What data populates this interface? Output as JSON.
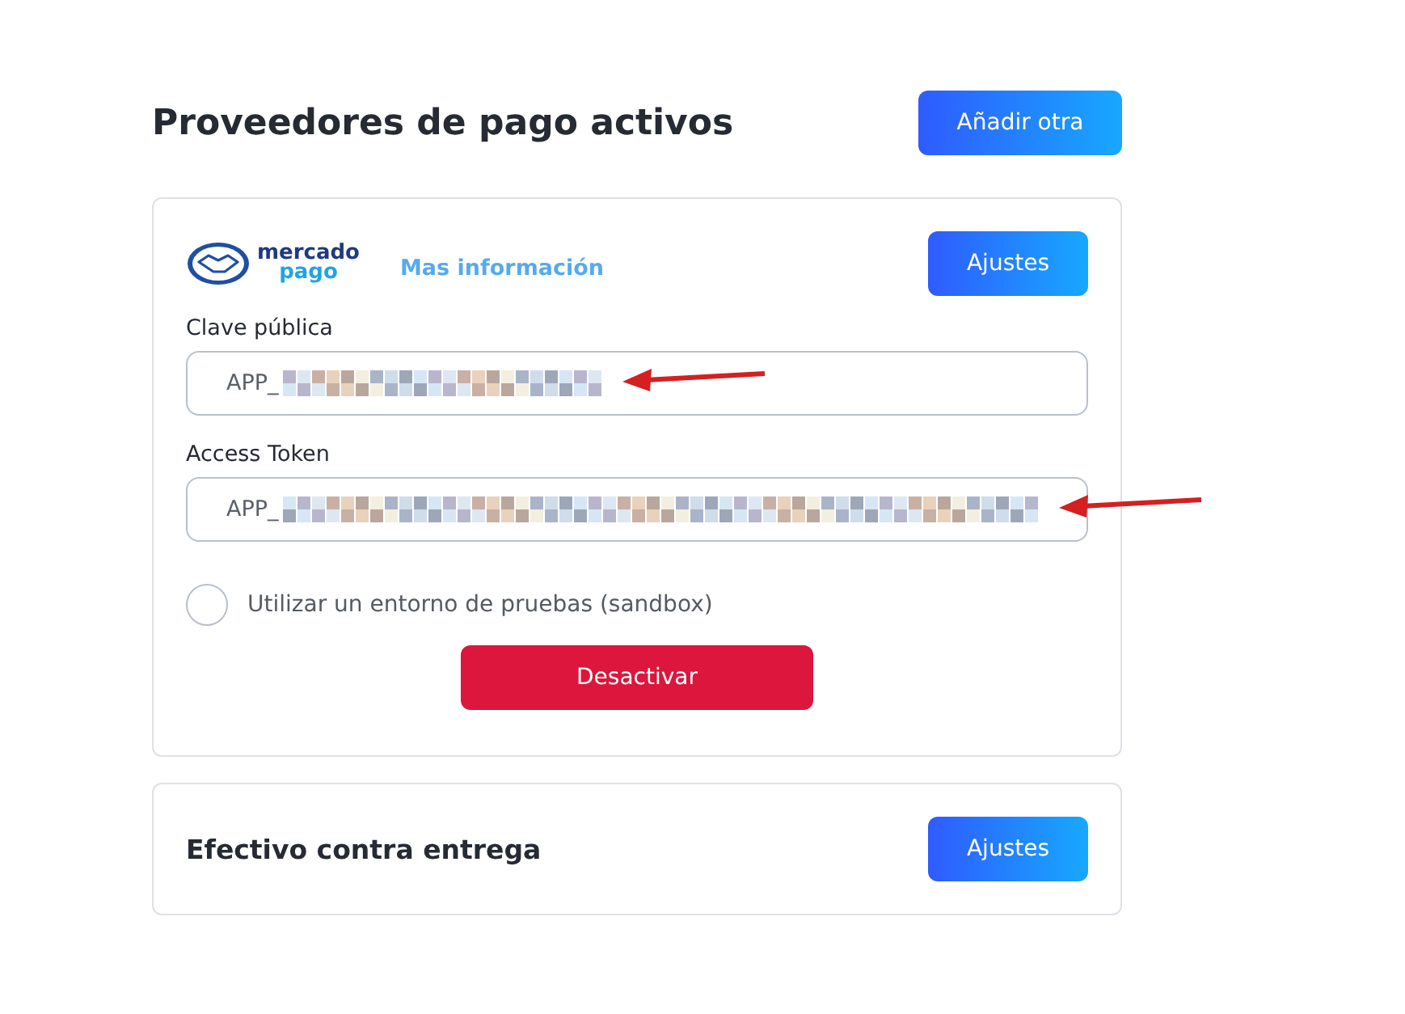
{
  "header": {
    "title": "Proveedores de pago activos",
    "add_button": "Añadir otra"
  },
  "providers": [
    {
      "kind": "gateway",
      "logo": {
        "line1": "mercado",
        "line2": "pago"
      },
      "info_link": "Mas información",
      "settings_button": "Ajustes",
      "fields": [
        {
          "label": "Clave pública",
          "value": "APP_",
          "annotated": true
        },
        {
          "label": "Access Token",
          "value": "APP_",
          "annotated": true
        }
      ],
      "sandbox": {
        "label": "Utilizar un entorno de pruebas (sandbox)",
        "checked": false
      },
      "deactivate_button": "Desactivar"
    },
    {
      "kind": "simple",
      "name": "Efectivo contra entrega",
      "settings_button": "Ajustes"
    }
  ]
}
